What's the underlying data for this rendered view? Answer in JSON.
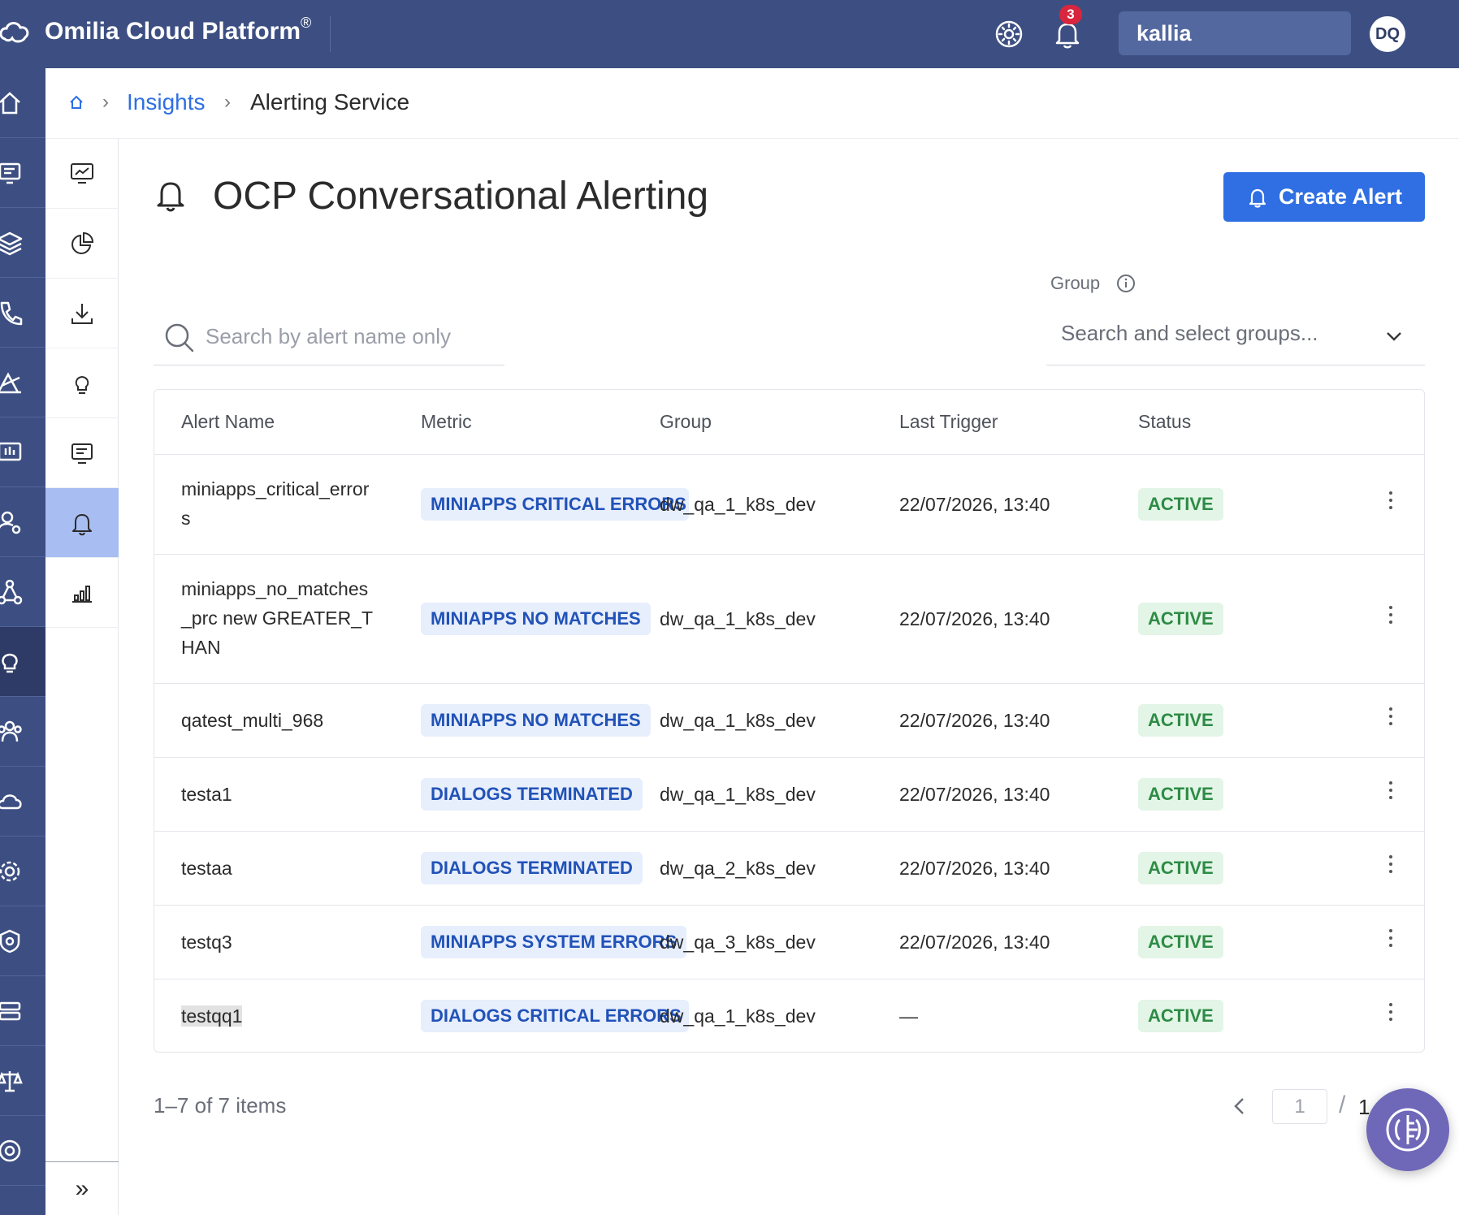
{
  "header": {
    "brand": "Omilia Cloud Platform",
    "brand_mark": "®",
    "notification_count": "3",
    "org": "kallia",
    "avatar_initials": "DQ"
  },
  "rail": [
    "home-icon",
    "people-monitor-icon",
    "layers-icon",
    "phone-book-icon",
    "analytics-icon",
    "presentation-icon",
    "user-settings-icon",
    "network-icon",
    "lightbulb-icon",
    "group-icon",
    "cloud-icon",
    "gear-icon",
    "shield-gear-icon",
    "server-icon",
    "scales-icon",
    "lifebuoy-icon"
  ],
  "subnav": [
    "monitor-chart-icon",
    "pie-chart-icon",
    "download-icon",
    "lightbulb-icon",
    "dashboard-report-icon",
    "bell-icon",
    "bar-chart-icon"
  ],
  "breadcrumb": {
    "parent": "Insights",
    "current": "Alerting Service"
  },
  "page": {
    "title": "OCP Conversational Alerting",
    "create_button": "Create Alert"
  },
  "search": {
    "placeholder": "Search by alert name only"
  },
  "group_filter": {
    "label": "Group",
    "placeholder": "Search and select groups..."
  },
  "table": {
    "headers": {
      "name": "Alert Name",
      "metric": "Metric",
      "group": "Group",
      "last_trigger": "Last Trigger",
      "status": "Status"
    },
    "rows": [
      {
        "name": "miniapps_critical_errors",
        "metric": "MINIAPPS CRITICAL ERRORS",
        "group": "dw_qa_1_k8s_dev",
        "last_trigger": "22/07/2026, 13:40",
        "status": "ACTIVE"
      },
      {
        "name": "miniapps_no_matches_prc new GREATER_THAN",
        "metric": "MINIAPPS NO MATCHES",
        "group": "dw_qa_1_k8s_dev",
        "last_trigger": "22/07/2026, 13:40",
        "status": "ACTIVE"
      },
      {
        "name": "qatest_multi_968",
        "metric": "MINIAPPS NO MATCHES",
        "group": "dw_qa_1_k8s_dev",
        "last_trigger": "22/07/2026, 13:40",
        "status": "ACTIVE"
      },
      {
        "name": "testa1",
        "metric": "DIALOGS TERMINATED",
        "group": "dw_qa_1_k8s_dev",
        "last_trigger": "22/07/2026, 13:40",
        "status": "ACTIVE"
      },
      {
        "name": "testaa",
        "metric": "DIALOGS TERMINATED",
        "group": "dw_qa_2_k8s_dev",
        "last_trigger": "22/07/2026, 13:40",
        "status": "ACTIVE"
      },
      {
        "name": "testq3",
        "metric": "MINIAPPS SYSTEM ERRORS",
        "group": "dw_qa_3_k8s_dev",
        "last_trigger": "22/07/2026, 13:40",
        "status": "ACTIVE"
      },
      {
        "name": "testqq1",
        "metric": "DIALOGS CRITICAL ERRORS",
        "group": "dw_qa_1_k8s_dev",
        "last_trigger": "—",
        "status": "ACTIVE"
      }
    ]
  },
  "pagination": {
    "summary": "1–7 of 7 items",
    "current_page": "1",
    "separator": "/",
    "total_pages": "1"
  },
  "colors": {
    "topbar": "#3d4f82",
    "primary": "#2f6fe3",
    "active_subnav": "#a8bdf2",
    "status_active": "#2e8b46"
  }
}
